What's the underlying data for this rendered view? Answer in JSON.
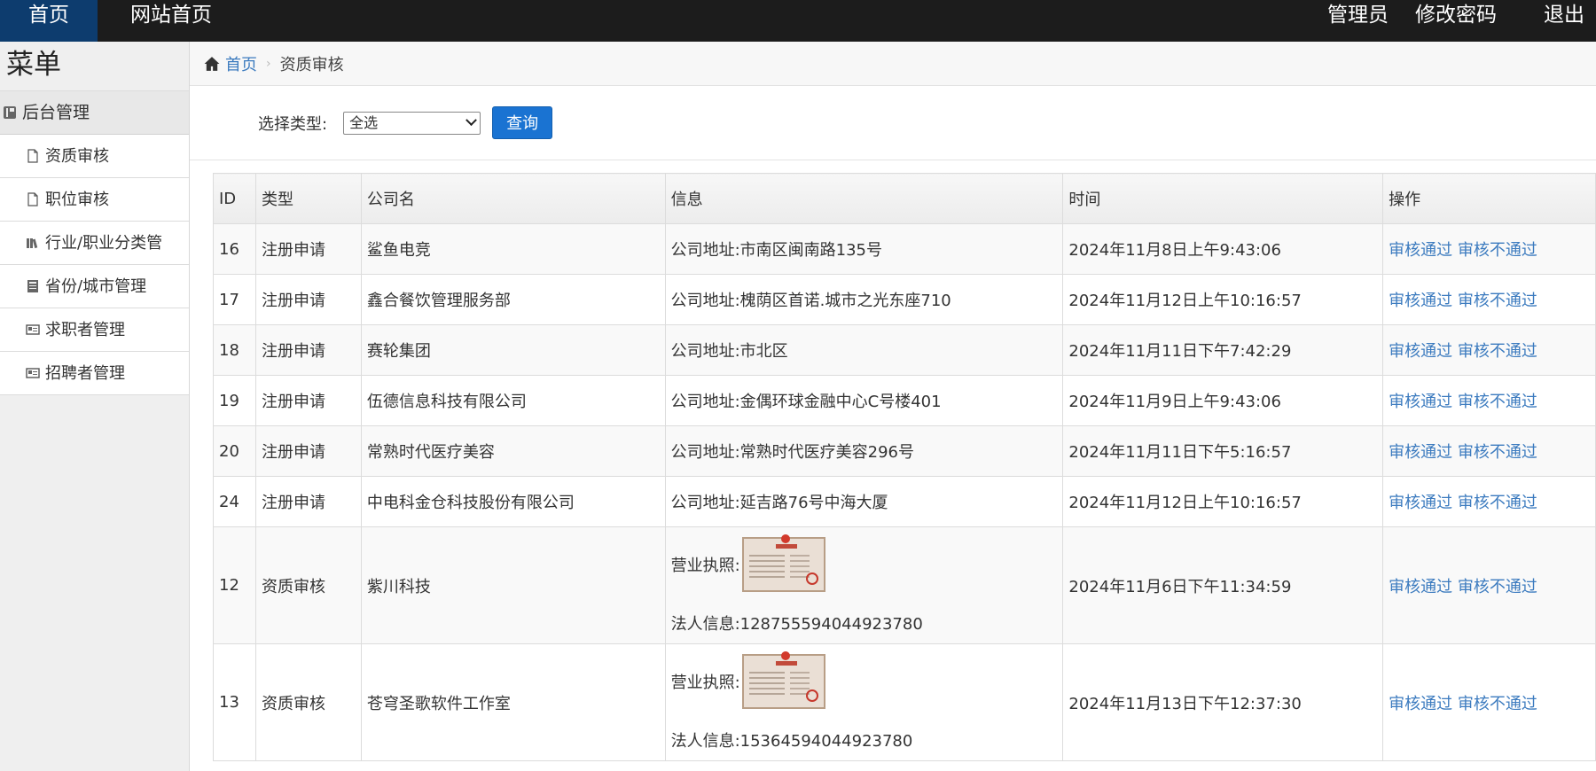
{
  "topbar": {
    "home_tab": "首页",
    "site_home": "网站首页",
    "admin": "管理员",
    "change_password": "修改密码",
    "logout": "退出"
  },
  "sidebar": {
    "title": "菜单",
    "section": "后台管理",
    "items": [
      {
        "label": "资质审核",
        "icon": "file-icon"
      },
      {
        "label": "职位审核",
        "icon": "file-icon"
      },
      {
        "label": "行业/职业分类管",
        "icon": "books-icon"
      },
      {
        "label": "省份/城市管理",
        "icon": "book-icon"
      },
      {
        "label": "求职者管理",
        "icon": "card-icon"
      },
      {
        "label": "招聘者管理",
        "icon": "card-icon"
      }
    ]
  },
  "breadcrumb": {
    "home": "首页",
    "current": "资质审核"
  },
  "filter": {
    "label": "选择类型:",
    "selected": "全选",
    "query_button": "查询"
  },
  "table": {
    "headers": [
      "ID",
      "类型",
      "公司名",
      "信息",
      "时间",
      "操作"
    ],
    "approve_label": "审核通过",
    "reject_label": "审核不通过",
    "rows": [
      {
        "id": "16",
        "type": "注册申请",
        "company": "鲨鱼电竞",
        "info": "公司地址:市南区闽南路135号",
        "time": "2024年11月8日上午9:43:06"
      },
      {
        "id": "17",
        "type": "注册申请",
        "company": "鑫合餐饮管理服务部",
        "info": "公司地址:槐荫区首诺.城市之光东座710",
        "time": "2024年11月12日上午10:16:57"
      },
      {
        "id": "18",
        "type": "注册申请",
        "company": "赛轮集团",
        "info": "公司地址:市北区",
        "time": "2024年11月11日下午7:42:29"
      },
      {
        "id": "19",
        "type": "注册申请",
        "company": "伍德信息科技有限公司",
        "info": "公司地址:金偶环球金融中心C号楼401",
        "time": "2024年11月9日上午9:43:06"
      },
      {
        "id": "20",
        "type": "注册申请",
        "company": "常熟时代医疗美容",
        "info": "公司地址:常熟时代医疗美容296号",
        "time": "2024年11月11日下午5:16:57"
      },
      {
        "id": "24",
        "type": "注册申请",
        "company": "中电科金仓科技股份有限公司",
        "info": "公司地址:延吉路76号中海大厦",
        "time": "2024年11月12日上午10:16:57"
      }
    ],
    "license_rows": [
      {
        "id": "12",
        "type": "资质审核",
        "company": "紫川科技",
        "license_label": "营业执照:",
        "legal": "法人信息:128755594044923780",
        "time": "2024年11月6日下午11:34:59"
      },
      {
        "id": "13",
        "type": "资质审核",
        "company": "苍穹圣歌软件工作室",
        "license_label": "营业执照:",
        "legal": "法人信息:15364594044923780",
        "time": "2024年11月13日下午12:37:30"
      }
    ]
  }
}
